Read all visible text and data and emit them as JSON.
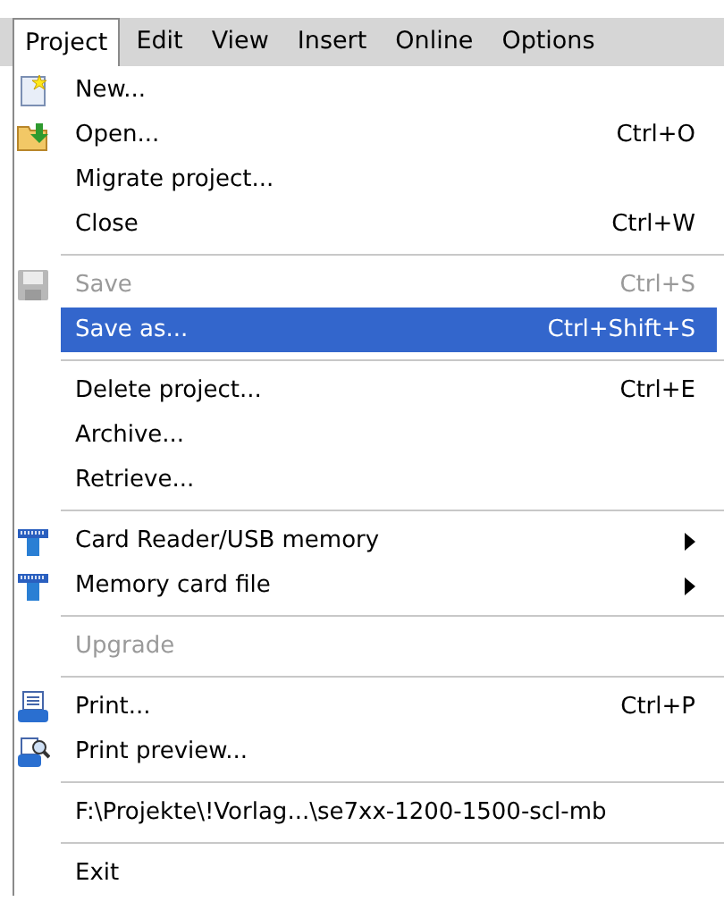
{
  "menubar": [
    {
      "label": "Project",
      "selected": true
    },
    {
      "label": "Edit",
      "selected": false
    },
    {
      "label": "View",
      "selected": false
    },
    {
      "label": "Insert",
      "selected": false
    },
    {
      "label": "Online",
      "selected": false
    },
    {
      "label": "Options",
      "selected": false
    }
  ],
  "menu": [
    {
      "kind": "item",
      "label": "New...",
      "disabled": false,
      "selected": false
    },
    {
      "kind": "item",
      "label": "Open...",
      "shortcut": "Ctrl+O",
      "disabled": false,
      "selected": false
    },
    {
      "kind": "item",
      "label": "Migrate project...",
      "disabled": false,
      "selected": false
    },
    {
      "kind": "item",
      "label": "Close",
      "shortcut": "Ctrl+W",
      "disabled": false,
      "selected": false
    },
    {
      "kind": "separator"
    },
    {
      "kind": "item",
      "label": "Save",
      "shortcut": "Ctrl+S",
      "disabled": true,
      "selected": false
    },
    {
      "kind": "item",
      "label": "Save as...",
      "shortcut": "Ctrl+Shift+S",
      "disabled": false,
      "selected": true
    },
    {
      "kind": "separator"
    },
    {
      "kind": "item",
      "label": "Delete project...",
      "shortcut": "Ctrl+E",
      "disabled": false,
      "selected": false
    },
    {
      "kind": "item",
      "label": "Archive...",
      "disabled": false,
      "selected": false
    },
    {
      "kind": "item",
      "label": "Retrieve...",
      "disabled": false,
      "selected": false
    },
    {
      "kind": "separator"
    },
    {
      "kind": "item",
      "label": "Card Reader/USB memory",
      "submenu": true,
      "disabled": false,
      "selected": false
    },
    {
      "kind": "item",
      "label": "Memory card file",
      "submenu": true,
      "disabled": false,
      "selected": false
    },
    {
      "kind": "separator"
    },
    {
      "kind": "item",
      "label": "Upgrade",
      "disabled": true,
      "selected": false
    },
    {
      "kind": "separator"
    },
    {
      "kind": "item",
      "label": "Print...",
      "shortcut": "Ctrl+P",
      "disabled": false,
      "selected": false
    },
    {
      "kind": "item",
      "label": "Print preview...",
      "disabled": false,
      "selected": false
    },
    {
      "kind": "separator"
    },
    {
      "kind": "item",
      "label": "F:\\Projekte\\!Vorlag...\\se7xx-1200-1500-scl-mb",
      "disabled": false,
      "selected": false
    },
    {
      "kind": "separator"
    },
    {
      "kind": "item",
      "label": "Exit",
      "disabled": false,
      "selected": false
    }
  ]
}
